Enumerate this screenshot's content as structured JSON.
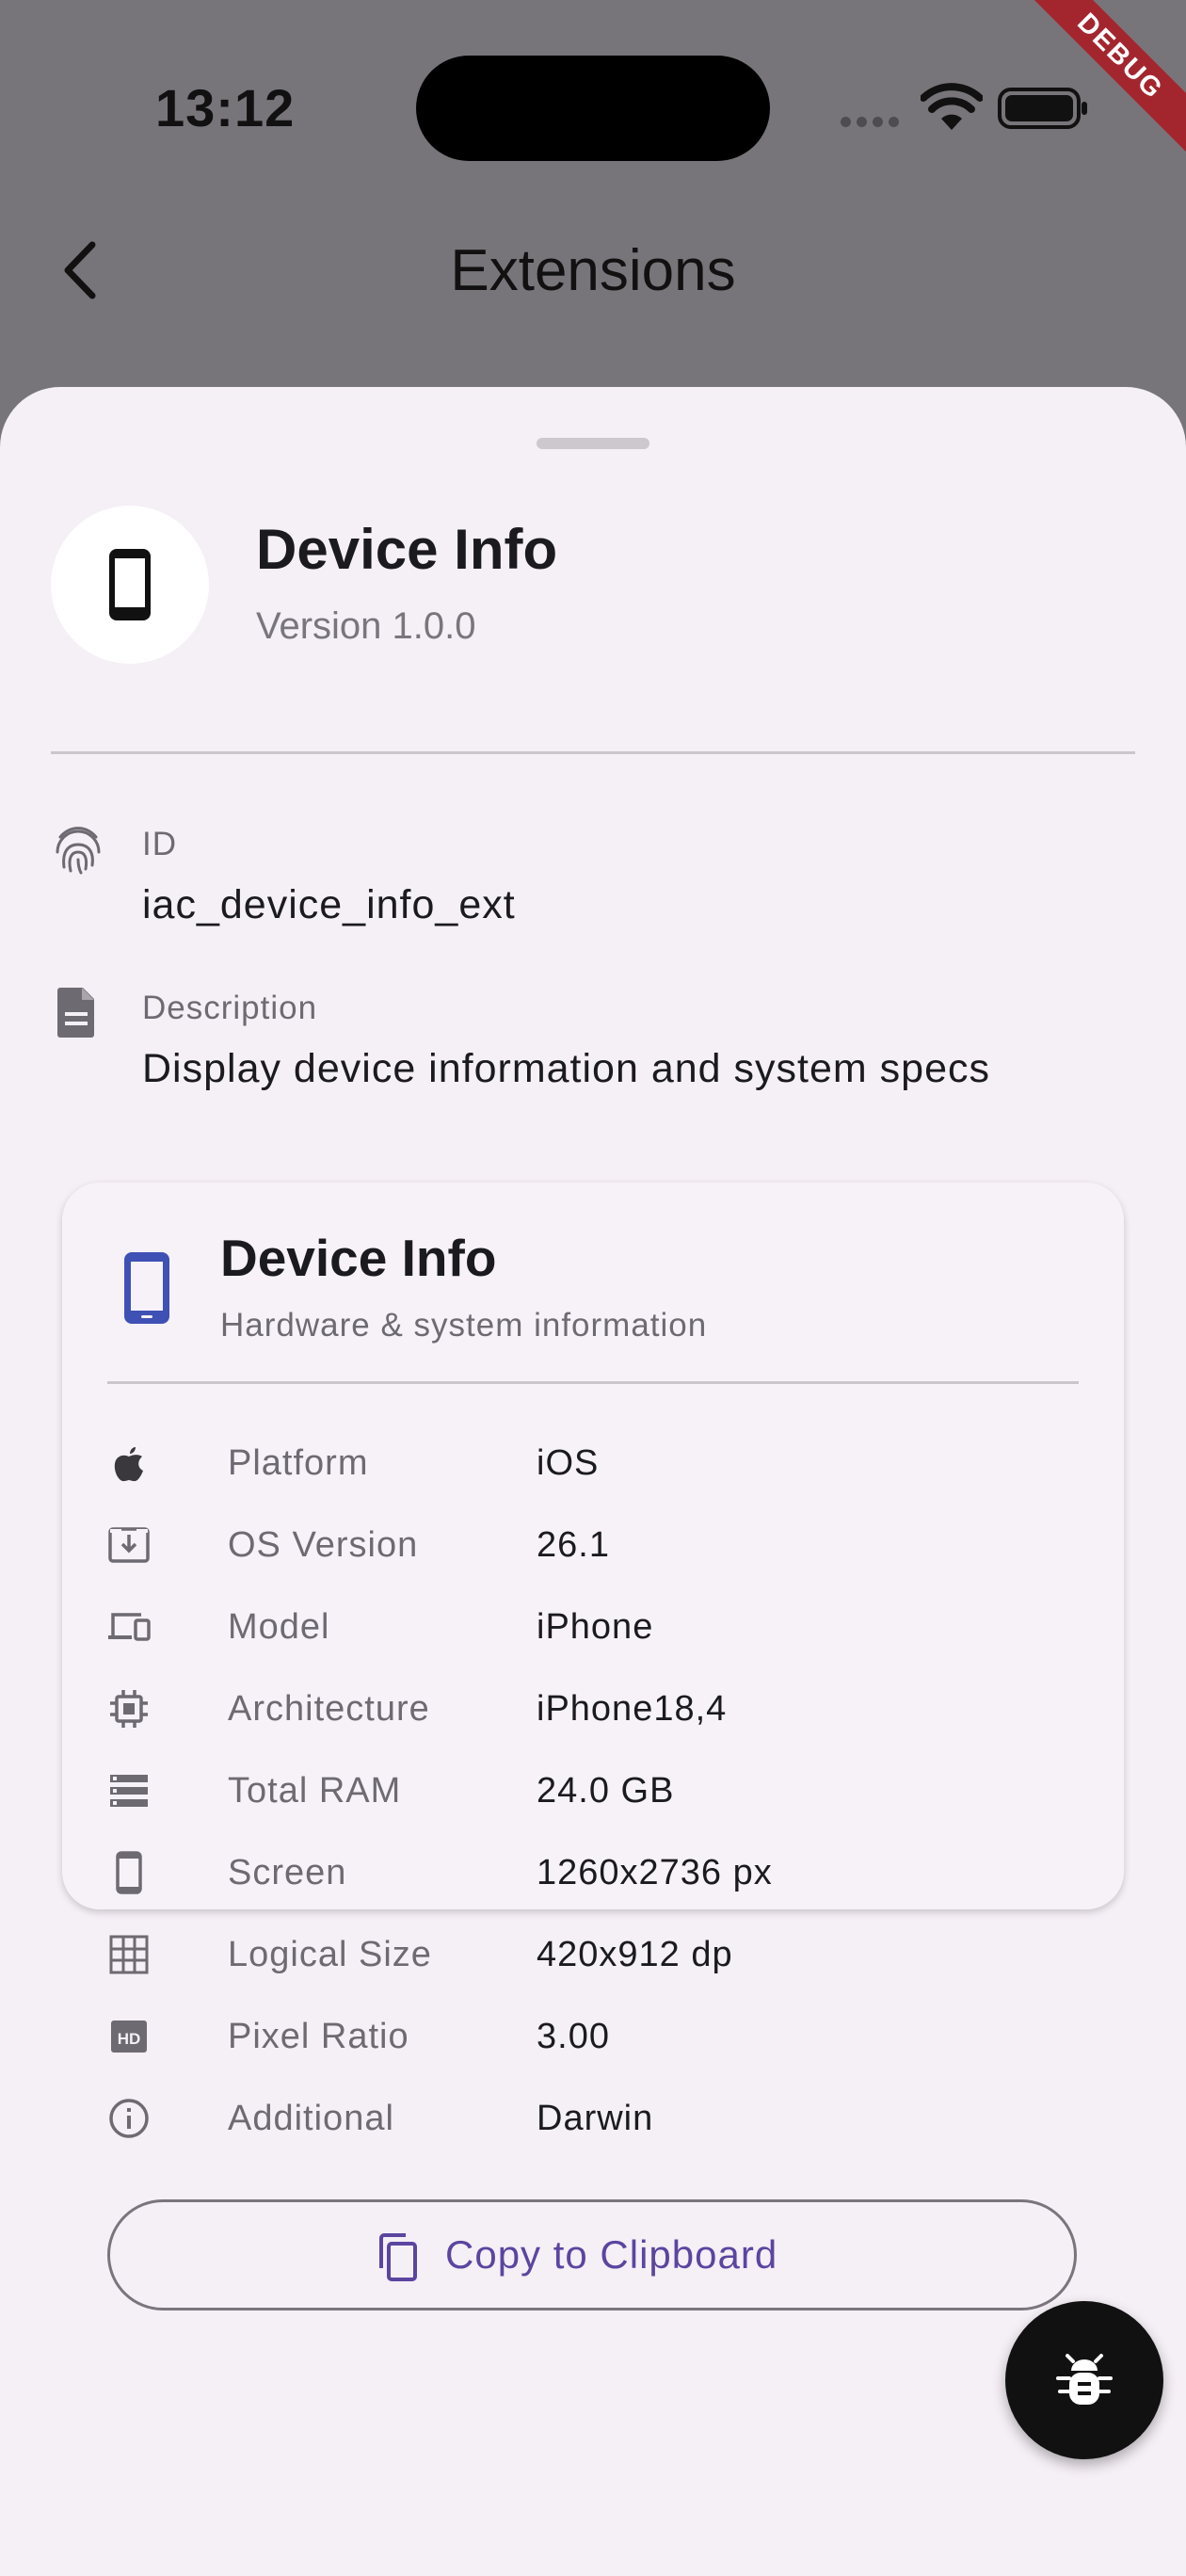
{
  "status_bar": {
    "time": "13:12",
    "debug_banner": "DEBUG"
  },
  "app_bar": {
    "title": "Extensions"
  },
  "extension": {
    "name": "Device Info",
    "version": "Version 1.0.0",
    "id_label": "ID",
    "id_value": "iac_device_info_ext",
    "description_label": "Description",
    "description_value": "Display device information and system specs"
  },
  "card": {
    "title": "Device Info",
    "subtitle": "Hardware & system information",
    "rows": [
      {
        "icon": "apple-icon",
        "label": "Platform",
        "value": "iOS"
      },
      {
        "icon": "system-update-icon",
        "label": "OS Version",
        "value": "26.1"
      },
      {
        "icon": "devices-icon",
        "label": "Model",
        "value": "iPhone"
      },
      {
        "icon": "chip-icon",
        "label": "Architecture",
        "value": "iPhone18,4"
      },
      {
        "icon": "storage-icon",
        "label": "Total RAM",
        "value": "24.0 GB"
      },
      {
        "icon": "phone-icon",
        "label": "Screen",
        "value": "1260x2736 px"
      },
      {
        "icon": "grid-icon",
        "label": "Logical Size",
        "value": "420x912 dp"
      },
      {
        "icon": "hd-icon",
        "label": "Pixel Ratio",
        "value": "3.00"
      },
      {
        "icon": "info-icon",
        "label": "Additional",
        "value": "Darwin"
      }
    ],
    "copy_button_label": "Copy to Clipboard"
  },
  "colors": {
    "accent": "#5b45a0",
    "card_icon": "#3f51b5",
    "sheet_background": "#f5eff6",
    "scrim": "#78757a"
  }
}
